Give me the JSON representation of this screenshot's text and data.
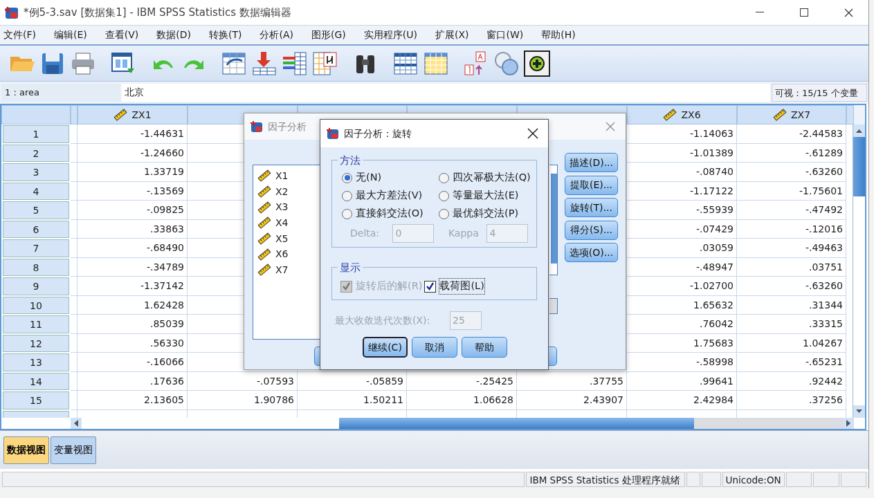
{
  "window": {
    "title": "*例5-3.sav [数据集1] - IBM SPSS Statistics 数据编辑器"
  },
  "menu": [
    "文件(F)",
    "编辑(E)",
    "查看(V)",
    "数据(D)",
    "转换(T)",
    "分析(A)",
    "图形(G)",
    "实用程序(U)",
    "扩展(X)",
    "窗口(W)",
    "帮助(H)"
  ],
  "cell_editor": {
    "cell_ref": "1 : area",
    "value": "北京",
    "visible_vars": "可视：15/15 个变量"
  },
  "grid": {
    "columns": [
      {
        "label": "ZX1"
      },
      {},
      {},
      {},
      {},
      {
        "label": "ZX6"
      },
      {
        "label": "ZX7"
      }
    ],
    "rows": [
      {
        "number": "1",
        "cells": [
          "-1.44631",
          null,
          null,
          null,
          null,
          "-1.14063",
          "-2.44583"
        ]
      },
      {
        "number": "2",
        "cells": [
          "-1.24660",
          null,
          null,
          null,
          null,
          "-1.01389",
          "-.61289"
        ]
      },
      {
        "number": "3",
        "cells": [
          "1.33719",
          null,
          null,
          null,
          null,
          "-.08740",
          "-.63260"
        ]
      },
      {
        "number": "4",
        "cells": [
          "-.13569",
          null,
          null,
          null,
          null,
          "-1.17122",
          "-1.75601"
        ]
      },
      {
        "number": "5",
        "cells": [
          "-.09825",
          null,
          null,
          null,
          null,
          "-.55939",
          "-.47492"
        ]
      },
      {
        "number": "6",
        "cells": [
          ".33863",
          null,
          null,
          null,
          null,
          "-.07429",
          "-.12016"
        ]
      },
      {
        "number": "7",
        "cells": [
          "-.68490",
          null,
          null,
          null,
          null,
          ".03059",
          "-.49463"
        ]
      },
      {
        "number": "8",
        "cells": [
          "-.34789",
          null,
          null,
          null,
          null,
          "-.48947",
          ".03751"
        ]
      },
      {
        "number": "9",
        "cells": [
          "-1.37142",
          null,
          null,
          null,
          null,
          "-1.02700",
          "-.63260"
        ]
      },
      {
        "number": "10",
        "cells": [
          "1.62428",
          null,
          null,
          null,
          null,
          "1.65632",
          ".31344"
        ]
      },
      {
        "number": "11",
        "cells": [
          ".85039",
          null,
          null,
          null,
          null,
          ".76042",
          ".33315"
        ]
      },
      {
        "number": "12",
        "cells": [
          ".56330",
          null,
          null,
          null,
          null,
          "1.75683",
          "1.04267"
        ]
      },
      {
        "number": "13",
        "cells": [
          "-.16066",
          null,
          null,
          null,
          null,
          "-.58998",
          "-.65231"
        ]
      },
      {
        "number": "14",
        "cells": [
          ".17636",
          "-.07593",
          "-.05859",
          "-.25425",
          ".37755",
          ".99641",
          ".92442"
        ]
      },
      {
        "number": "15",
        "cells": [
          "2.13605",
          "1.90786",
          "1.50211",
          "1.06628",
          "2.43907",
          "2.42984",
          ".37256"
        ]
      }
    ]
  },
  "view_tabs": [
    {
      "label": "数据视图",
      "selected": true
    },
    {
      "label": "变量视图",
      "selected": false
    }
  ],
  "status_bar": {
    "processor": "IBM SPSS Statistics 处理程序就绪",
    "unicode": "Unicode:ON"
  },
  "factor_dialog": {
    "title": "因子分析",
    "variables": [
      "X1",
      "X2",
      "X3",
      "X4",
      "X5",
      "X6",
      "X7"
    ],
    "buttons": [
      "描述(D)...",
      "提取(E)...",
      "旋转(T)...",
      "得分(S)...",
      "选项(O)..."
    ]
  },
  "rotation_dialog": {
    "title": "因子分析：旋转",
    "method_group": "方法",
    "methods": [
      {
        "label": "无(N)",
        "selected": true
      },
      {
        "label": "四次幂极大法(Q)",
        "selected": false
      },
      {
        "label": "最大方差法(V)",
        "selected": false
      },
      {
        "label": "等量最大法(E)",
        "selected": false
      },
      {
        "label": "直接斜交法(O)",
        "selected": false
      },
      {
        "label": "最优斜交法(P)",
        "selected": false
      }
    ],
    "delta": {
      "label": "Delta:",
      "value": "0",
      "disabled": true
    },
    "kappa": {
      "label": "Kappa",
      "value": "4",
      "disabled": true
    },
    "display_group": "显示",
    "display_options": [
      {
        "label": "旋转后的解(R)",
        "checked": true,
        "disabled": true
      },
      {
        "label": "载荷图(L)",
        "checked": true,
        "disabled": false
      }
    ],
    "iterations": {
      "label": "最大收敛迭代次数(X):",
      "value": "25",
      "disabled": true
    },
    "buttons": [
      {
        "label": "继续(C)",
        "default": true
      },
      {
        "label": "取消",
        "default": false
      },
      {
        "label": "帮助",
        "default": false
      }
    ]
  }
}
